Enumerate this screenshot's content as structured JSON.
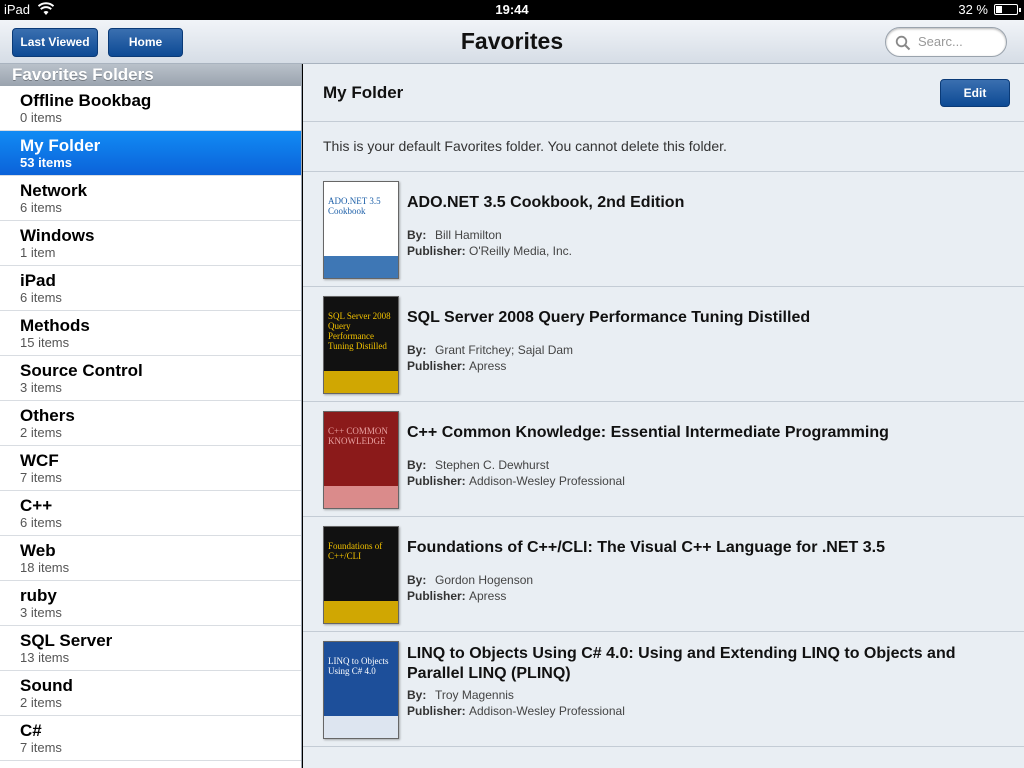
{
  "status_bar": {
    "device": "iPad",
    "time": "19:44",
    "battery": "32 %",
    "battery_level": 0.32
  },
  "nav": {
    "last_viewed": "Last Viewed",
    "home": "Home",
    "title": "Favorites",
    "search_placeholder": "Searc..."
  },
  "sidebar": {
    "header": "Favorites Folders",
    "folders": [
      {
        "name": "Offline Bookbag",
        "count": "0 items"
      },
      {
        "name": "My Folder",
        "count": "53 items"
      },
      {
        "name": "Network",
        "count": "6 items"
      },
      {
        "name": "Windows",
        "count": "1 item"
      },
      {
        "name": "iPad",
        "count": "6 items"
      },
      {
        "name": "Methods",
        "count": "15 items"
      },
      {
        "name": "Source Control",
        "count": "3 items"
      },
      {
        "name": "Others",
        "count": "2 items"
      },
      {
        "name": "WCF",
        "count": "7 items"
      },
      {
        "name": "C++",
        "count": "6 items"
      },
      {
        "name": "Web",
        "count": "18 items"
      },
      {
        "name": "ruby",
        "count": "3 items"
      },
      {
        "name": "SQL Server",
        "count": "13 items"
      },
      {
        "name": "Sound",
        "count": "2 items"
      },
      {
        "name": "C#",
        "count": "7 items"
      }
    ]
  },
  "main": {
    "folder_title": "My Folder",
    "edit": "Edit",
    "description": "This is your default Favorites folder. You cannot delete this folder.",
    "by_label": "By:",
    "publisher_label": "Publisher:",
    "books": [
      {
        "title": "ADO.NET 3.5 Cookbook, 2nd Edition",
        "author": "Bill Hamilton",
        "publisher": "O'Reilly Media, Inc.",
        "cover_text": "ADO.NET 3.5 Cookbook",
        "cover_color": "#ffffff",
        "cover_accent": "#1c5fa8"
      },
      {
        "title": "SQL Server 2008 Query Performance Tuning Distilled",
        "author": "Grant Fritchey; Sajal Dam",
        "publisher": "Apress",
        "cover_text": "SQL Server 2008 Query Performance Tuning Distilled",
        "cover_color": "#111111",
        "cover_accent": "#f2c200"
      },
      {
        "title": "C++ Common Knowledge: Essential Intermediate Programming",
        "author": "Stephen C. Dewhurst",
        "publisher": "Addison-Wesley Professional",
        "cover_text": "C++ COMMON KNOWLEDGE",
        "cover_color": "#8b1a1a",
        "cover_accent": "#e8a0a0"
      },
      {
        "title": "Foundations of C++/CLI: The Visual C++ Language for .NET 3.5",
        "author": "Gordon Hogenson",
        "publisher": "Apress",
        "cover_text": "Foundations of C++/CLI",
        "cover_color": "#111111",
        "cover_accent": "#f2c200"
      },
      {
        "title": "LINQ to Objects Using C# 4.0: Using and Extending LINQ to Objects and Parallel LINQ (PLINQ)",
        "author": "Troy Magennis",
        "publisher": "Addison-Wesley Professional",
        "cover_text": "LINQ to Objects Using C# 4.0",
        "cover_color": "#1d4f9a",
        "cover_accent": "#ffffff"
      }
    ]
  }
}
